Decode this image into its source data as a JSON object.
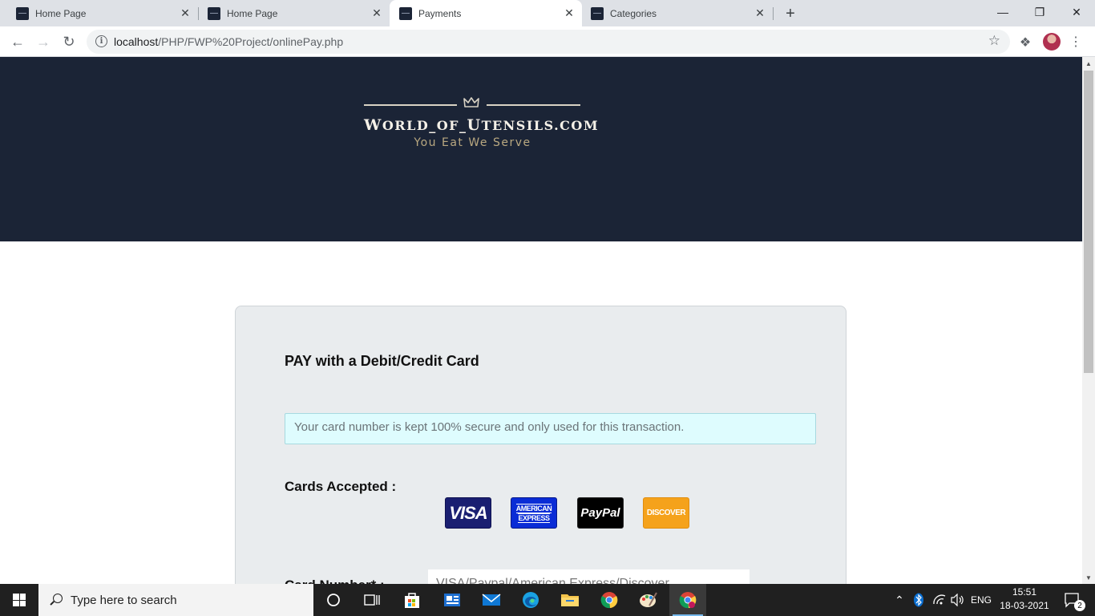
{
  "browser": {
    "tabs": [
      {
        "title": "Home Page",
        "active": false
      },
      {
        "title": "Home Page",
        "active": false
      },
      {
        "title": "Payments",
        "active": true
      },
      {
        "title": "Categories",
        "active": false
      }
    ],
    "url_host": "localhost",
    "url_path": "/PHP/FWP%20Project/onlinePay.php",
    "close_glyph": "✕",
    "new_tab_glyph": "+",
    "minimize_glyph": "—",
    "restore_glyph": "❐",
    "window_close_glyph": "✕"
  },
  "site": {
    "brand_prefix": "W",
    "brand_rest": "ORLD_OF_",
    "brand_u": "U",
    "brand_tensils": "TENSILS.COM",
    "tagline": "You Eat We Serve"
  },
  "payment": {
    "title": "PAY with a Debit/Credit Card",
    "notice": "Your card number is kept 100% secure and only used for this transaction.",
    "cards_label": "Cards Accepted :",
    "cards": [
      {
        "name": "VISA",
        "icon": "visa-logo",
        "color": "#1a1f71"
      },
      {
        "name": "AMERICAN EXPRESS",
        "line1": "AMERICAN",
        "line2": "EXPRESS",
        "icon": "amex-logo",
        "color": "#0a2cd6"
      },
      {
        "name": "PayPal",
        "icon": "paypal-logo",
        "color": "#000000"
      },
      {
        "name": "DISCOVER",
        "icon": "discover-logo",
        "color": "#f5a21b"
      }
    ],
    "card_number_label": "Card Number* :",
    "card_number_placeholder": "VISA/Paypal/American Express/Discover"
  },
  "taskbar": {
    "search_placeholder": "Type here to search",
    "language": "ENG",
    "time": "15:51",
    "date": "18-03-2021",
    "notification_count": "2"
  },
  "colors": {
    "hero_bg": "#1b2436",
    "brand_text": "#f5f1e8",
    "tagline": "#b9a880",
    "card_bg": "#e9ecee",
    "notice_bg": "#defcfe"
  }
}
